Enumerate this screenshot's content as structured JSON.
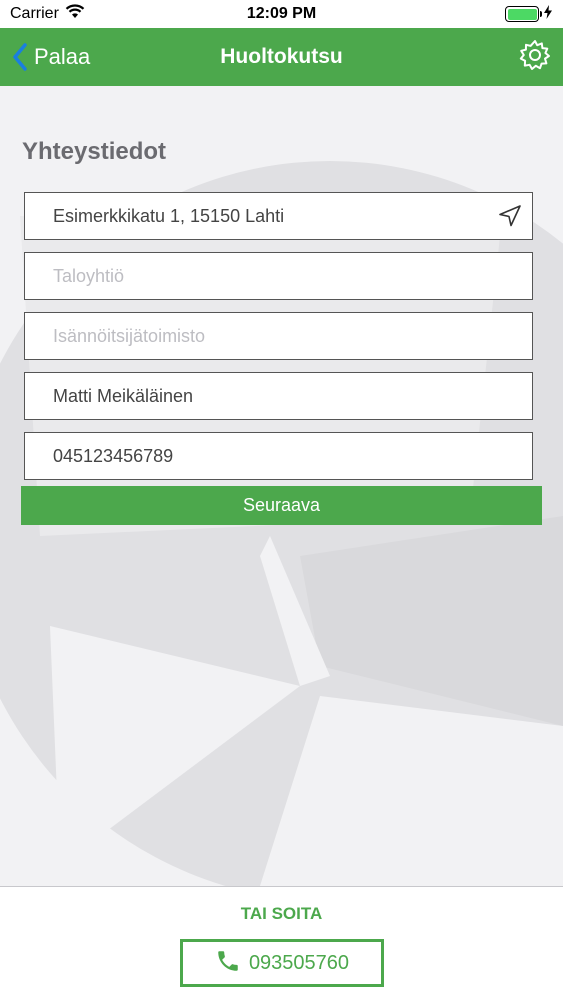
{
  "status_bar": {
    "carrier": "Carrier",
    "time": "12:09 PM",
    "battery_color": "#4cd964"
  },
  "nav": {
    "back_label": "Palaa",
    "title": "Huoltokutsu",
    "settings_icon": "gear-icon",
    "bar_color": "#4ca84c"
  },
  "form": {
    "section_title": "Yhteystiedot",
    "fields": [
      {
        "name": "address",
        "value": "Esimerkkikatu 1, 15150 Lahti",
        "placeholder": ""
      },
      {
        "name": "housing-company",
        "value": "",
        "placeholder": "Taloyhtiö"
      },
      {
        "name": "property-manager",
        "value": "",
        "placeholder": "Isännöitsijätoimisto"
      },
      {
        "name": "name",
        "value": "Matti Meikäläinen",
        "placeholder": ""
      },
      {
        "name": "phone",
        "value": "045123456789",
        "placeholder": ""
      }
    ],
    "next_label": "Seuraava"
  },
  "footer": {
    "or_call_label": "TAI SOITA",
    "phone_number": "093505760"
  }
}
